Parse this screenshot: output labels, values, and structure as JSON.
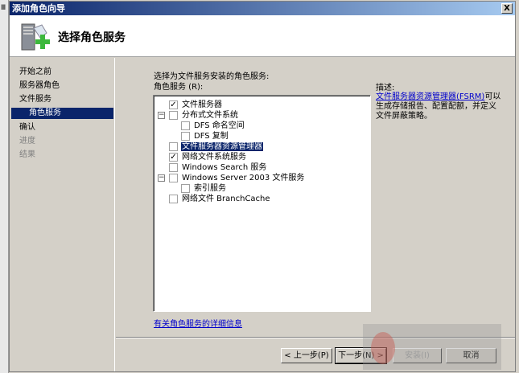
{
  "left_strip_icon": "Ⅲ",
  "window": {
    "title": "添加角色向导",
    "close": "X"
  },
  "header": {
    "title": "选择角色服务",
    "icon": "server-add-icon"
  },
  "nav": [
    {
      "label": "开始之前",
      "state": "normal"
    },
    {
      "label": "服务器角色",
      "state": "normal"
    },
    {
      "label": "文件服务",
      "state": "normal"
    },
    {
      "label": "角色服务",
      "state": "selected"
    },
    {
      "label": "确认",
      "state": "normal"
    },
    {
      "label": "进度",
      "state": "disabled"
    },
    {
      "label": "结果",
      "state": "disabled"
    }
  ],
  "content": {
    "instruction": "选择为文件服务安装的角色服务:",
    "list_label": "角色服务 (R):",
    "items": [
      {
        "label": "文件服务器",
        "checked": true,
        "level": 0,
        "expander": false
      },
      {
        "label": "分布式文件系统",
        "checked": false,
        "level": 0,
        "expander": true
      },
      {
        "label": "DFS 命名空间",
        "checked": false,
        "level": 1
      },
      {
        "label": "DFS 复制",
        "checked": false,
        "level": 1
      },
      {
        "label": "文件服务器资源管理器",
        "checked": false,
        "level": 0,
        "selected": true
      },
      {
        "label": "网络文件系统服务",
        "checked": true,
        "level": 0
      },
      {
        "label": "Windows Search 服务",
        "checked": false,
        "level": 0
      },
      {
        "label": "Windows Server 2003 文件服务",
        "checked": false,
        "level": 0,
        "expander": true
      },
      {
        "label": "索引服务",
        "checked": false,
        "level": 1
      },
      {
        "label": "网络文件 BranchCache",
        "checked": false,
        "level": 0
      }
    ],
    "desc_label": "描述:",
    "desc_link": "文件服务器资源管理器(FSRM)",
    "desc_text1": "可以",
    "desc_text2": "生成存储报告、配置配额，并定义",
    "desc_text3": "文件屏蔽策略。",
    "more_link": "有关角色服务的详细信息"
  },
  "buttons": {
    "prev": "< 上一步(P)",
    "next": "下一步(N) >",
    "install": "安装(I)",
    "cancel": "取消"
  }
}
